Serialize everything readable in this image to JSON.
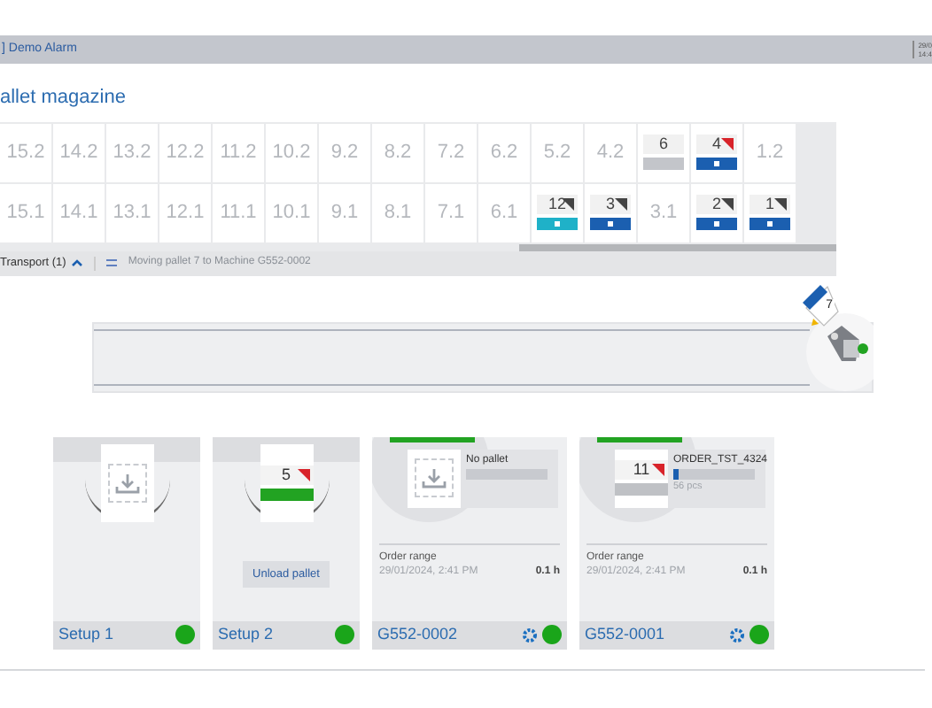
{
  "header": {
    "title": "] Demo Alarm",
    "clock": [
      "29/0",
      "14:4"
    ]
  },
  "page_title": "allet magazine",
  "magazine": {
    "rows": [
      [
        {
          "kind": "slot",
          "label": "15.2"
        },
        {
          "kind": "slot",
          "label": "14.2"
        },
        {
          "kind": "slot",
          "label": "13.2"
        },
        {
          "kind": "slot",
          "label": "12.2"
        },
        {
          "kind": "slot",
          "label": "11.2"
        },
        {
          "kind": "slot",
          "label": "10.2"
        },
        {
          "kind": "slot",
          "label": "9.2"
        },
        {
          "kind": "slot",
          "label": "8.2"
        },
        {
          "kind": "slot",
          "label": "7.2"
        },
        {
          "kind": "slot",
          "label": "6.2"
        },
        {
          "kind": "slot",
          "label": "5.2"
        },
        {
          "kind": "slot",
          "label": "4.2"
        },
        {
          "kind": "pallet",
          "label": "6",
          "color": "#c3c5ca",
          "flagged": false
        },
        {
          "kind": "pallet",
          "label": "4",
          "color": "#1b5fb0",
          "flagged": true,
          "alert": true
        },
        {
          "kind": "slot",
          "label": "1.2"
        }
      ],
      [
        {
          "kind": "slot",
          "label": "15.1"
        },
        {
          "kind": "slot",
          "label": "14.1"
        },
        {
          "kind": "slot",
          "label": "13.1"
        },
        {
          "kind": "slot",
          "label": "12.1"
        },
        {
          "kind": "slot",
          "label": "11.1"
        },
        {
          "kind": "slot",
          "label": "10.1"
        },
        {
          "kind": "slot",
          "label": "9.1"
        },
        {
          "kind": "slot",
          "label": "8.1"
        },
        {
          "kind": "slot",
          "label": "7.1"
        },
        {
          "kind": "slot",
          "label": "6.1"
        },
        {
          "kind": "pallet",
          "label": "12",
          "color": "#1fb1c8",
          "flagged": true,
          "alert": false
        },
        {
          "kind": "pallet",
          "label": "3",
          "color": "#1b5fb0",
          "flagged": true,
          "alert": false
        },
        {
          "kind": "slot",
          "label": "3.1"
        },
        {
          "kind": "pallet",
          "label": "2",
          "color": "#1b5fb0",
          "flagged": true,
          "alert": false
        },
        {
          "kind": "pallet",
          "label": "1",
          "color": "#1b5fb0",
          "flagged": true,
          "alert": false
        }
      ]
    ]
  },
  "transport": {
    "label": "Transport (1)",
    "expanded": true,
    "message": "Moving pallet 7 to Machine G552-0002"
  },
  "crane": {
    "pallet": "7"
  },
  "stations": [
    {
      "kind": "setup",
      "name": "Setup 1",
      "color": "#1aa51a"
    },
    {
      "kind": "setup",
      "name": "Setup 2",
      "color": "#1aa51a",
      "pallet": "5",
      "button": "Unload pallet"
    },
    {
      "kind": "machine",
      "name": "G552-0002",
      "color": "#1aa51a",
      "order": "No pallet",
      "range_label": "Order range",
      "range": "29/01/2024, 2:41 PM",
      "time": "0.1 h"
    },
    {
      "kind": "machine",
      "name": "G552-0001",
      "color": "#1aa51a",
      "pallet": "11",
      "order": "ORDER_TST_4324",
      "progress": "56 pcs",
      "level": 0.06,
      "range_label": "Order range",
      "range": "29/01/2024, 2:41 PM",
      "time": "0.1 h"
    }
  ]
}
